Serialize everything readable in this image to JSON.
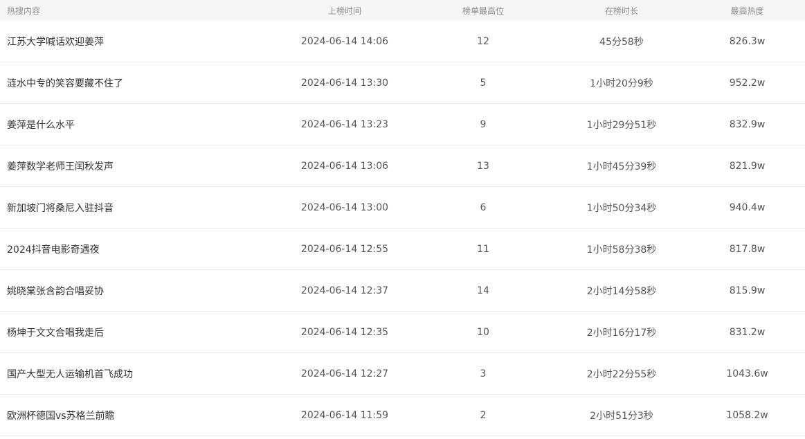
{
  "table": {
    "headers": {
      "topic": "热搜内容",
      "time": "上榜时间",
      "rank": "榜单最高位",
      "duration": "在榜时长",
      "heat": "最高热度"
    },
    "rows": [
      {
        "topic": "江苏大学喊话欢迎姜萍",
        "time": "2024-06-14 14:06",
        "rank": "12",
        "duration": "45分58秒",
        "heat": "826.3w"
      },
      {
        "topic": "涟水中专的笑容要藏不住了",
        "time": "2024-06-14 13:30",
        "rank": "5",
        "duration": "1小时20分9秒",
        "heat": "952.2w"
      },
      {
        "topic": "姜萍是什么水平",
        "time": "2024-06-14 13:23",
        "rank": "9",
        "duration": "1小时29分51秒",
        "heat": "832.9w"
      },
      {
        "topic": "姜萍数学老师王闰秋发声",
        "time": "2024-06-14 13:06",
        "rank": "13",
        "duration": "1小时45分39秒",
        "heat": "821.9w"
      },
      {
        "topic": "新加坡门将桑尼入驻抖音",
        "time": "2024-06-14 13:00",
        "rank": "6",
        "duration": "1小时50分34秒",
        "heat": "940.4w"
      },
      {
        "topic": "2024抖音电影奇遇夜",
        "time": "2024-06-14 12:55",
        "rank": "11",
        "duration": "1小时58分38秒",
        "heat": "817.8w"
      },
      {
        "topic": "姚晓棠张含韵合唱妥协",
        "time": "2024-06-14 12:37",
        "rank": "14",
        "duration": "2小时14分58秒",
        "heat": "815.9w"
      },
      {
        "topic": "杨坤于文文合唱我走后",
        "time": "2024-06-14 12:35",
        "rank": "10",
        "duration": "2小时16分17秒",
        "heat": "831.2w"
      },
      {
        "topic": "国产大型无人运输机首飞成功",
        "time": "2024-06-14 12:27",
        "rank": "3",
        "duration": "2小时22分55秒",
        "heat": "1043.6w"
      },
      {
        "topic": "欧洲杯德国vs苏格兰前瞻",
        "time": "2024-06-14 11:59",
        "rank": "2",
        "duration": "2小时51分3秒",
        "heat": "1058.2w"
      }
    ]
  }
}
